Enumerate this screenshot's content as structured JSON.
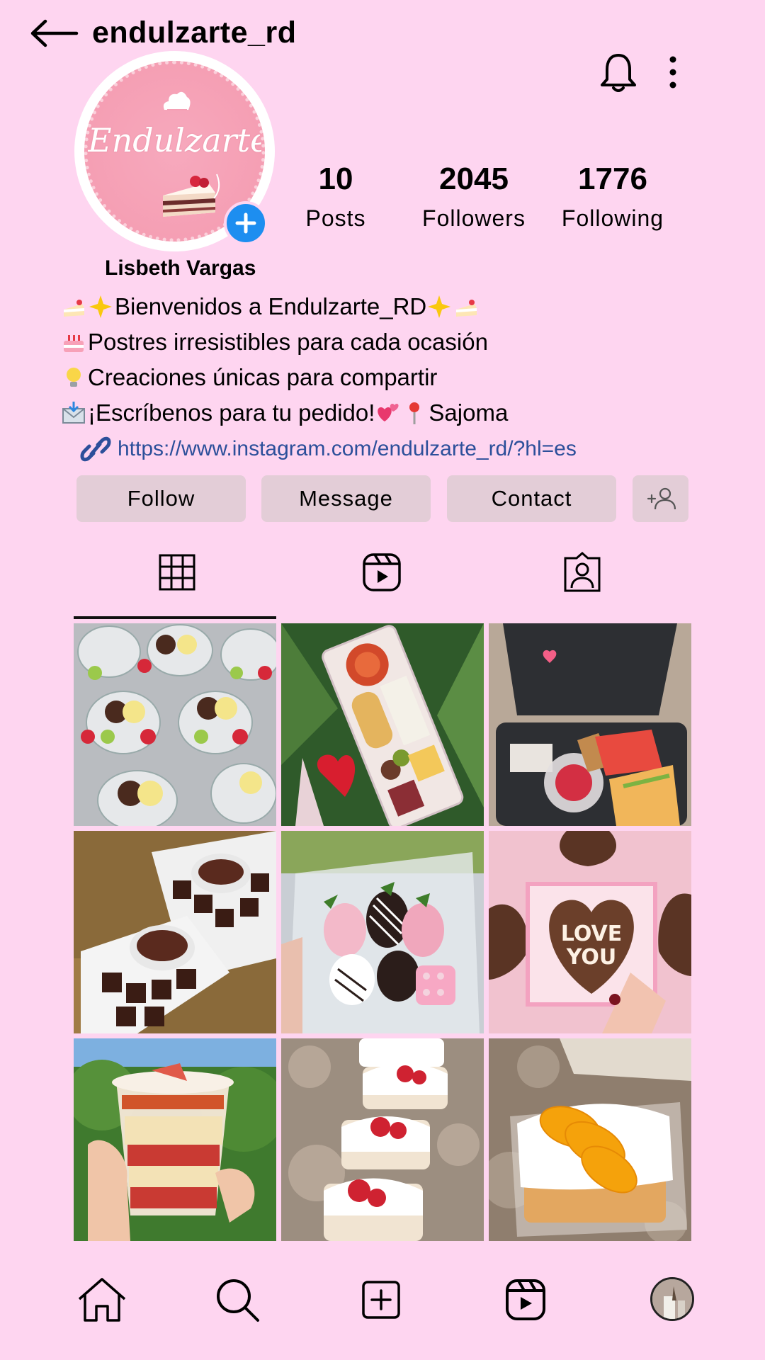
{
  "header": {
    "username": "endulzarte_rd",
    "back_icon": "arrow-left-icon",
    "bell_icon": "bell-icon",
    "more_icon": "more-vertical-icon"
  },
  "avatar": {
    "logo_text": "Endulzarte",
    "add_icon": "plus-icon",
    "colors": {
      "ring": "#ffffff",
      "fill": "#f59fb4",
      "add_button": "#1d8ef0"
    }
  },
  "stats": [
    {
      "value": "10",
      "label": "Posts"
    },
    {
      "value": "2045",
      "label": "Followers"
    },
    {
      "value": "1776",
      "label": "Following"
    }
  ],
  "profile": {
    "display_name": "Lisbeth Vargas",
    "bio": [
      {
        "emoji": [
          "cake-icon",
          "sparkles-icon"
        ],
        "text": "Bienvenidos a Endulzarte_RD",
        "trailing": [
          "sparkles-icon",
          "cake-icon"
        ]
      },
      {
        "emoji": [
          "birthday-cake-icon"
        ],
        "text": "Postres irresistibles para cada ocasión"
      },
      {
        "emoji": [
          "lightbulb-icon"
        ],
        "text": "Creaciones únicas para compartir"
      },
      {
        "emoji": [
          "envelope-icon"
        ],
        "text": "¡Escríbenos para tu pedido!",
        "trailing": [
          "hearts-icon",
          "pin-icon"
        ],
        "trailing_text": "Sajoma"
      }
    ],
    "link_icon": "link-icon",
    "link": "https://www.instagram.com/endulzarte_rd/?hl=es"
  },
  "buttons": {
    "follow": "Follow",
    "message": "Message",
    "contact": "Contact",
    "suggest_icon": "add-person-icon"
  },
  "tabs": [
    {
      "icon": "grid-icon",
      "active": true
    },
    {
      "icon": "reels-icon",
      "active": false
    },
    {
      "icon": "tagged-icon",
      "active": false
    }
  ],
  "posts": [
    {
      "subject": "fruit and chocolate dip cups"
    },
    {
      "subject": "charcuterie board with rose"
    },
    {
      "subject": "breakfast box"
    },
    {
      "subject": "brownies with chocolate dip"
    },
    {
      "subject": "chocolate covered strawberries"
    },
    {
      "subject": "love you heart brownie"
    },
    {
      "subject": "strawberry parfait cup"
    },
    {
      "subject": "strawberry cream cakes"
    },
    {
      "subject": "peach cream cake"
    }
  ],
  "bottom_nav": [
    "home-icon",
    "search-icon",
    "create-icon",
    "reels-icon",
    "profile-avatar"
  ],
  "colors": {
    "background": "#fed5f0",
    "button": "#e3cdd7",
    "link": "#2c4f9a"
  }
}
